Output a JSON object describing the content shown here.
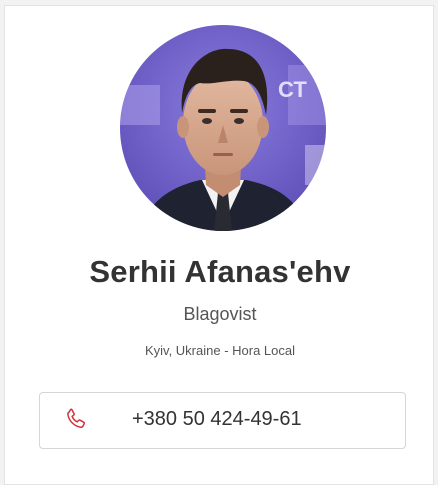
{
  "profile": {
    "name": "Serhii Afanas'ehv",
    "company": "Blagovist",
    "location": "Kyiv, Ukraine - Hora Local",
    "avatar_icon": "person-photo",
    "background_banner_text": "СТ"
  },
  "contact": {
    "phone": "+380 50 424-49-61",
    "phone_icon": "phone-icon",
    "phone_icon_color": "#d0343a"
  },
  "colors": {
    "photo_background": "#6b5cc4",
    "text_primary": "#333333",
    "text_secondary": "#555555"
  }
}
